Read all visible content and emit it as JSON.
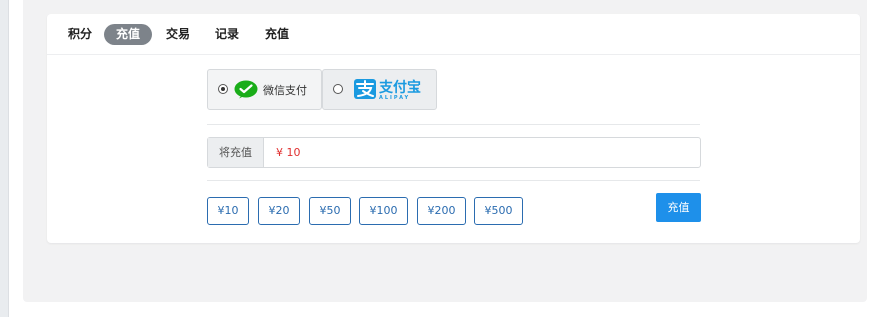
{
  "tabs": {
    "points": "积分",
    "recharge": "充值",
    "trade": "交易",
    "records": "记录",
    "recharge2": "充值"
  },
  "payment": {
    "wechat_label": "微信支付",
    "wechat_selected": true,
    "alipay_label": "支付宝",
    "alipay_sub": "ALIPAY"
  },
  "amount": {
    "prefix": "将充值",
    "value": "¥ 10"
  },
  "presets": [
    "¥10",
    "¥20",
    "¥50",
    "¥100",
    "¥200",
    "¥500"
  ],
  "submit_label": "充值",
  "colors": {
    "accent": "#1e90ea",
    "preset_border": "#2b6cb0",
    "amount_text": "#e03030",
    "wechat_green": "#1aad19",
    "alipay_blue": "#1a9ae0",
    "active_tab": "#7d838a"
  }
}
